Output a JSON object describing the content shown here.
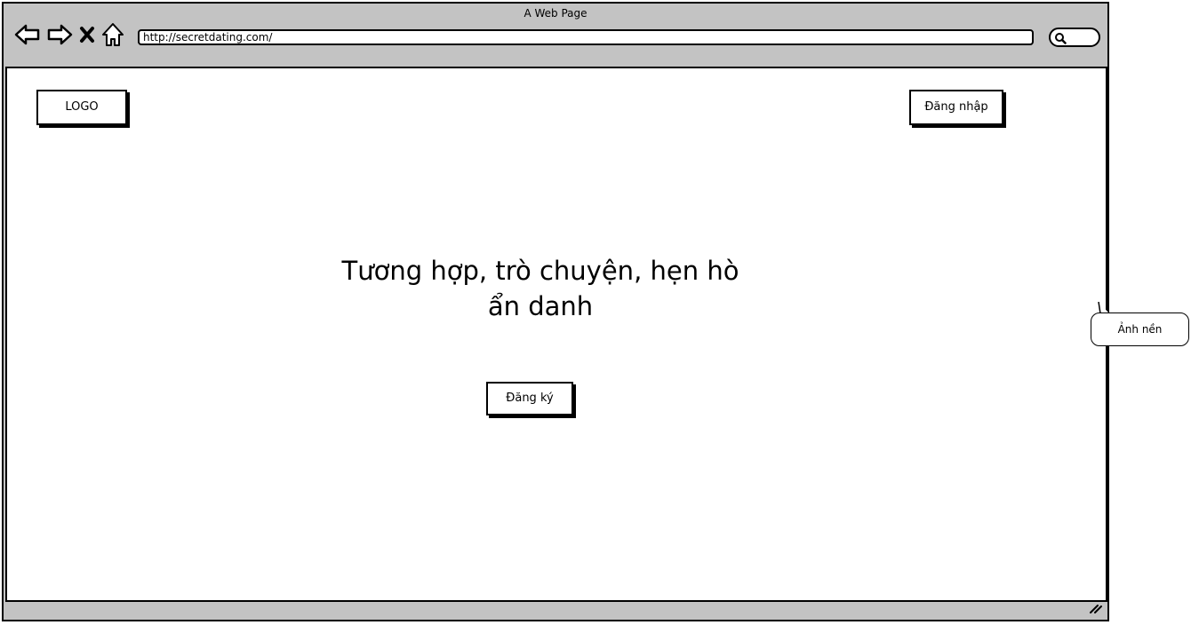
{
  "window": {
    "title": "A Web Page"
  },
  "browser": {
    "url": "http://secretdating.com/",
    "nav_icons": [
      "back-arrow-icon",
      "forward-arrow-icon",
      "close-x-icon",
      "home-icon"
    ],
    "search_icon": "search-icon"
  },
  "page": {
    "logo_label": "LOGO",
    "login_label": "Đăng nhập",
    "headline_line1": "Tương hợp, trò chuyện, hẹn hò",
    "headline_line2": "ẩn danh",
    "signup_label": "Đăng ký"
  },
  "annotation": {
    "callout_text": "Ảnh nền"
  }
}
